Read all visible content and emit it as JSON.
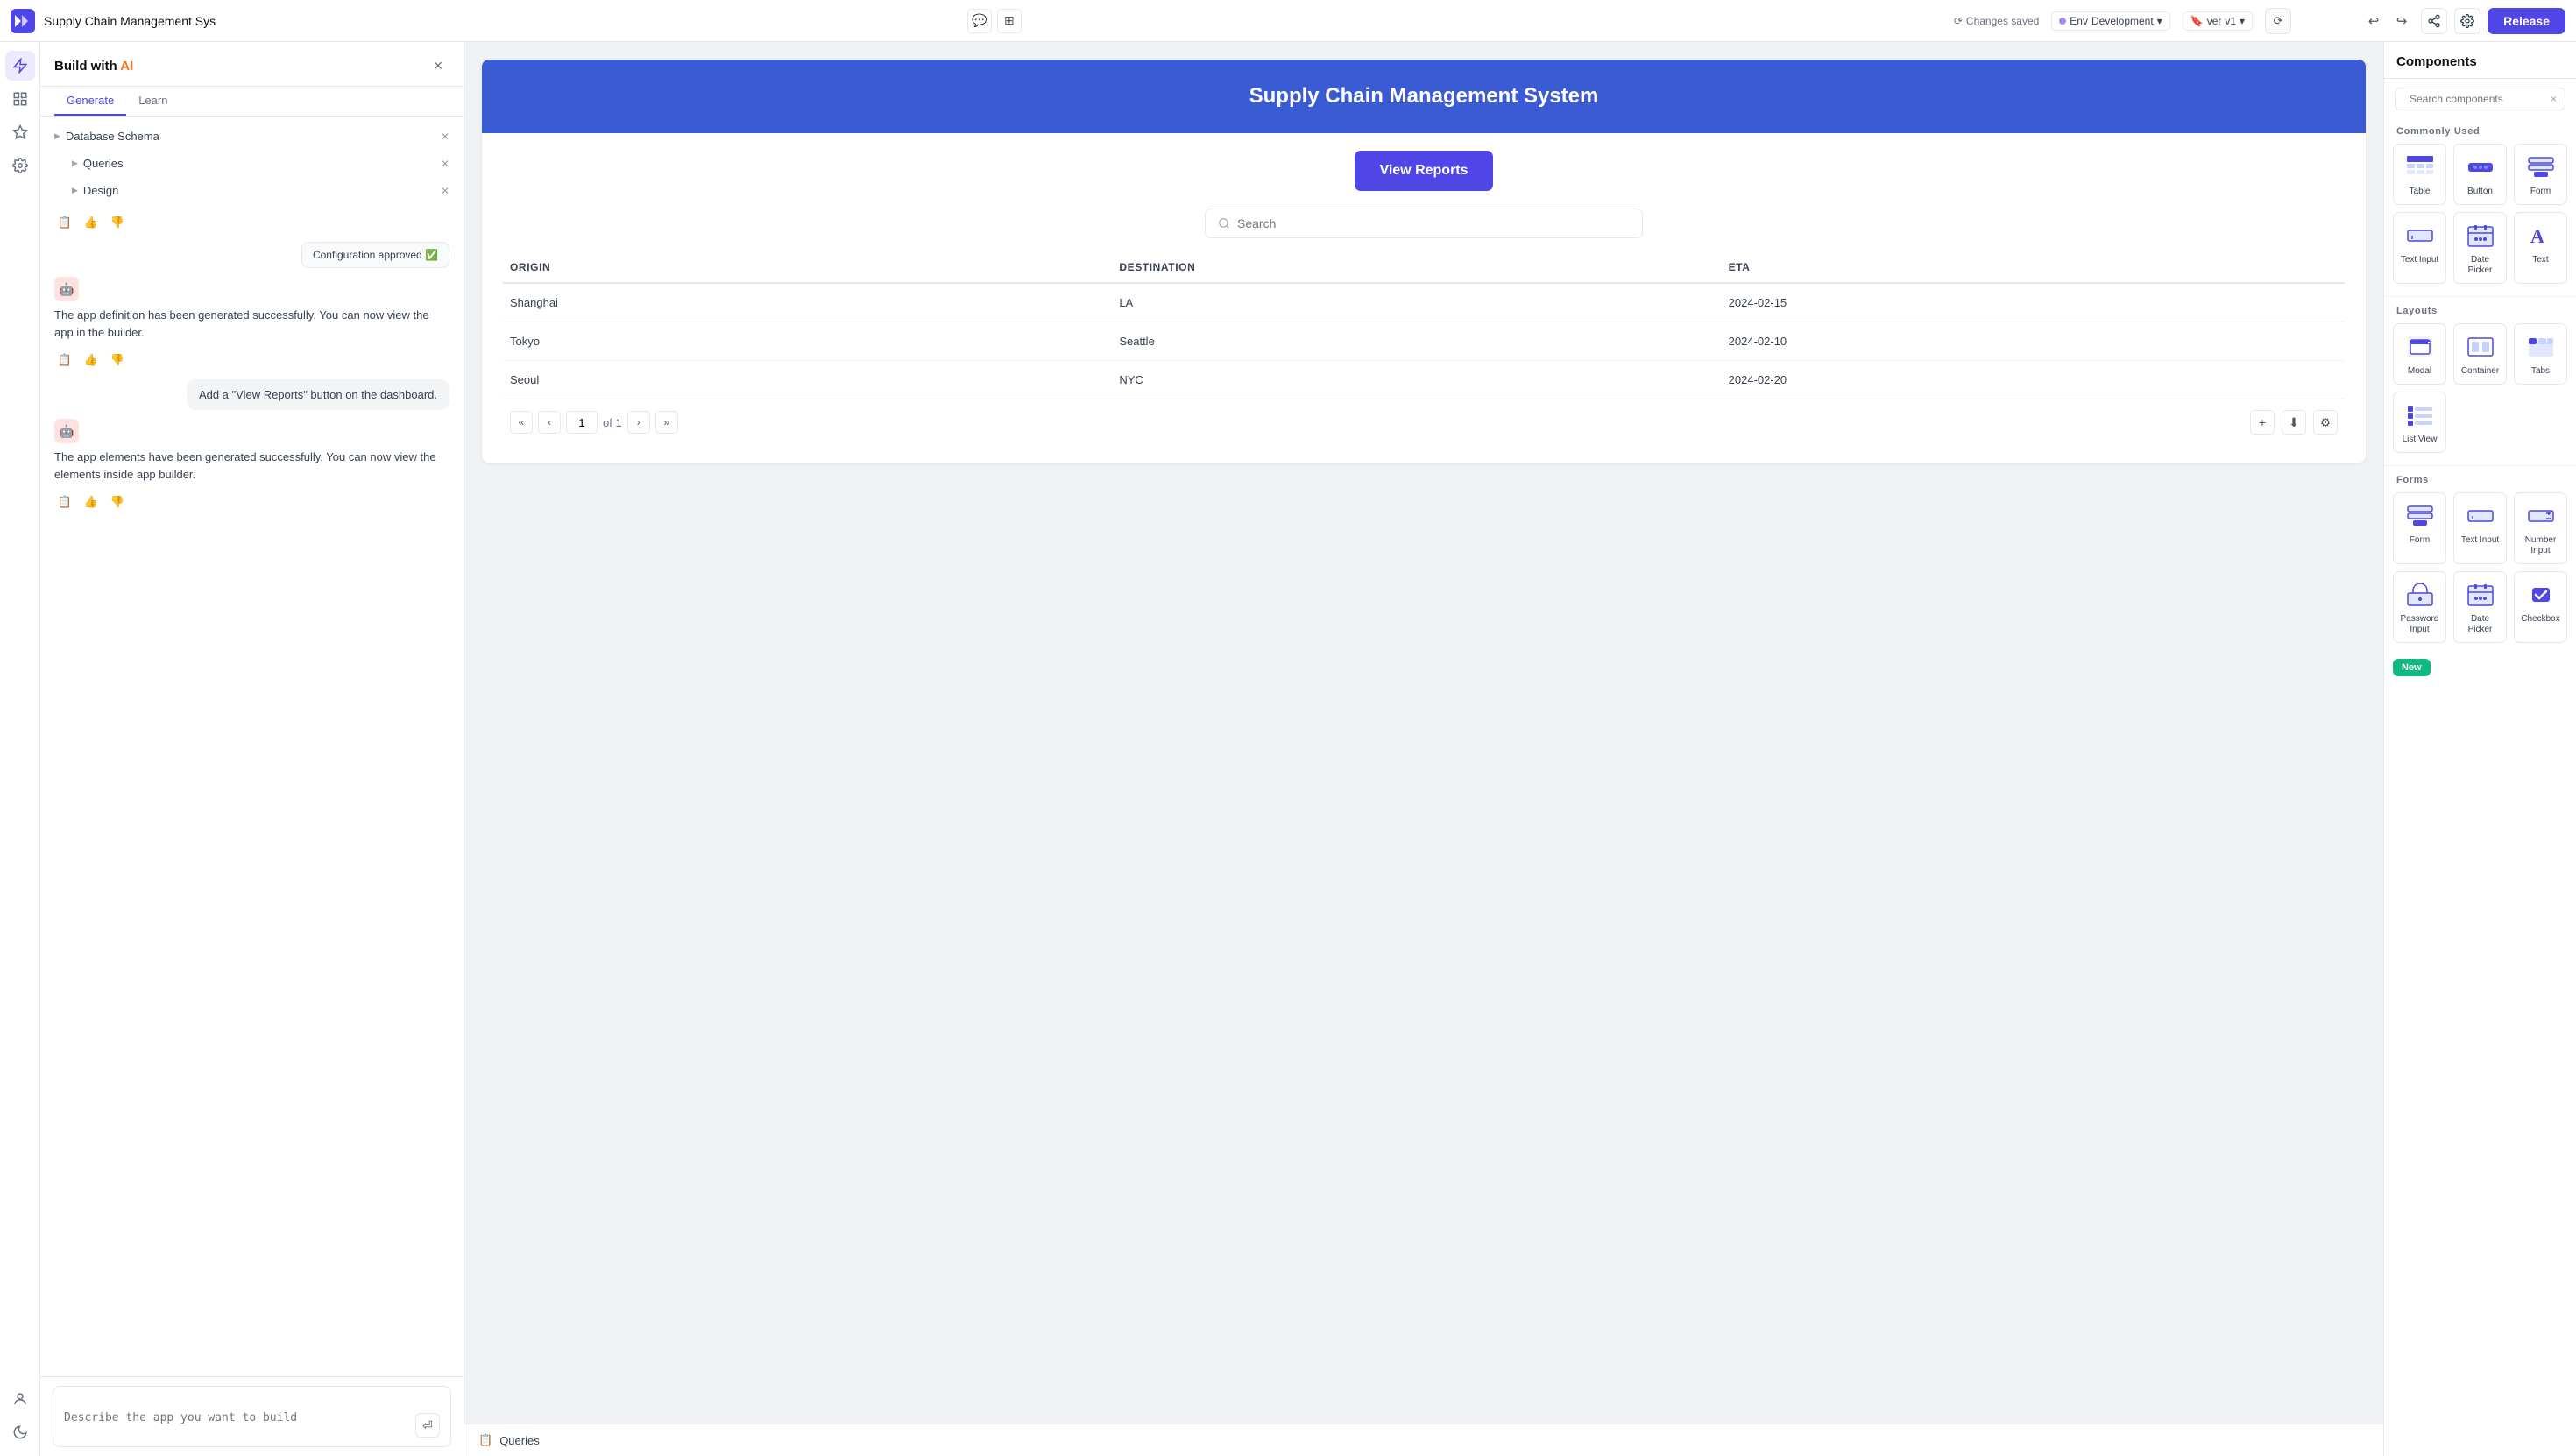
{
  "topbar": {
    "logo": "▶▶",
    "title": "Supply Chain Management Sys",
    "changes_saved": "Changes saved",
    "env_label": "Env",
    "env_value": "Development",
    "ver_label": "ver",
    "ver_value": "v1",
    "undo_icon": "↩",
    "redo_icon": "↪",
    "release_label": "Release"
  },
  "ai_panel": {
    "title_prefix": "Build with ",
    "title_ai": "AI",
    "close_label": "×",
    "tabs": [
      {
        "id": "generate",
        "label": "Generate"
      },
      {
        "id": "learn",
        "label": "Learn"
      }
    ],
    "tree": {
      "items": [
        {
          "label": "Database Schema",
          "level": 1
        },
        {
          "label": "Queries",
          "level": 2
        },
        {
          "label": "Design",
          "level": 2
        }
      ]
    },
    "config_badge": "Configuration approved ✅",
    "message1": "The app definition has been generated successfully. You can now view the app in the builder.",
    "user_msg1": "Add a \"View Reports\" button on the dashboard.",
    "message2": "The app elements have been generated successfully. You can now view the elements inside app builder.",
    "input_placeholder": "Describe the app you want to build"
  },
  "canvas": {
    "app_header": "Supply Chain Management System",
    "view_reports_btn": "View Reports",
    "search_placeholder": "Search",
    "table": {
      "headers": [
        "ORIGIN",
        "DESTINATION",
        "ETA"
      ],
      "rows": [
        [
          "Shanghai",
          "LA",
          "2024-02-15"
        ],
        [
          "Tokyo",
          "Seattle",
          "2024-02-10"
        ],
        [
          "Seoul",
          "NYC",
          "2024-02-20"
        ]
      ]
    },
    "pagination": {
      "current_page": "1",
      "total_pages": "1"
    }
  },
  "queries_panel": {
    "icon": "📋",
    "label": "Queries"
  },
  "right_panel": {
    "title": "Components",
    "search_placeholder": "Search components",
    "sections": [
      {
        "title": "Commonly Used",
        "items": [
          {
            "id": "table",
            "label": "Table"
          },
          {
            "id": "button",
            "label": "Button"
          },
          {
            "id": "form",
            "label": "Form"
          },
          {
            "id": "text-input",
            "label": "Text Input"
          },
          {
            "id": "date-picker",
            "label": "Date Picker"
          },
          {
            "id": "text",
            "label": "Text"
          }
        ]
      },
      {
        "title": "Layouts",
        "items": [
          {
            "id": "modal",
            "label": "Modal"
          },
          {
            "id": "container",
            "label": "Container"
          },
          {
            "id": "tabs",
            "label": "Tabs"
          },
          {
            "id": "list-view",
            "label": "List View"
          }
        ]
      },
      {
        "title": "Forms",
        "items": [
          {
            "id": "form2",
            "label": "Form"
          },
          {
            "id": "text-input2",
            "label": "Text Input"
          },
          {
            "id": "number-input",
            "label": "Number Input"
          },
          {
            "id": "password-input",
            "label": "Password Input"
          },
          {
            "id": "date-picker2",
            "label": "Date Picker"
          },
          {
            "id": "checkbox",
            "label": "Checkbox"
          }
        ]
      }
    ]
  }
}
